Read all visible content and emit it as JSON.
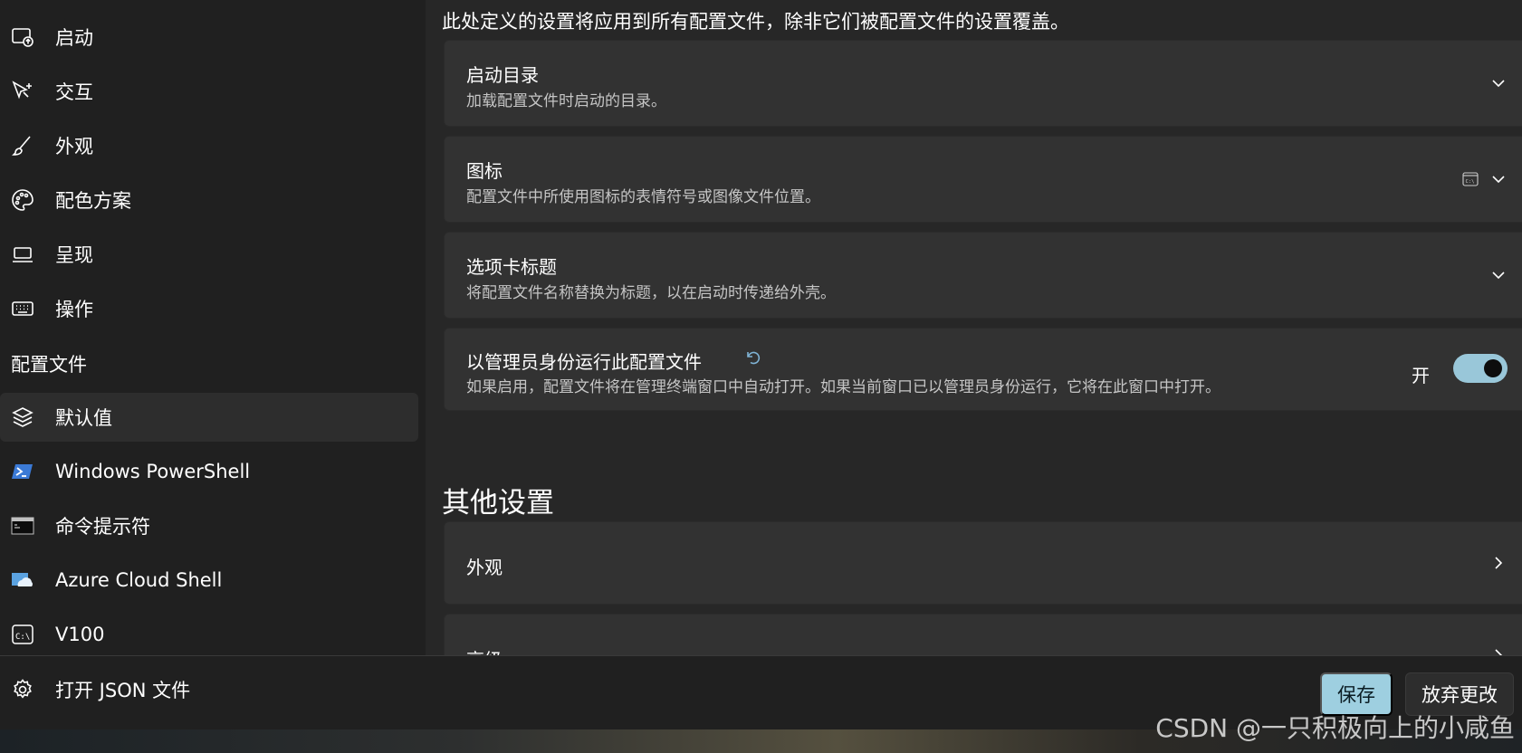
{
  "sidebar": {
    "items": [
      {
        "label": "启动",
        "icon": "startup-icon"
      },
      {
        "label": "交互",
        "icon": "interaction-icon"
      },
      {
        "label": "外观",
        "icon": "brush-icon"
      },
      {
        "label": "配色方案",
        "icon": "palette-icon"
      },
      {
        "label": "呈现",
        "icon": "laptop-icon"
      },
      {
        "label": "操作",
        "icon": "keyboard-icon"
      }
    ],
    "profiles_header": "配置文件",
    "profiles": [
      {
        "label": "默认值",
        "icon": "layers-icon",
        "selected": true
      },
      {
        "label": "Windows PowerShell",
        "icon": "powershell-icon"
      },
      {
        "label": "命令提示符",
        "icon": "cmd-icon"
      },
      {
        "label": "Azure Cloud Shell",
        "icon": "azure-icon"
      },
      {
        "label": "V100",
        "icon": "terminal-icon"
      }
    ],
    "open_json": {
      "label": "打开 JSON 文件",
      "icon": "gear-icon"
    }
  },
  "main": {
    "intro": "此处定义的设置将应用到所有配置文件，除非它们被配置文件的设置覆盖。",
    "cards": [
      {
        "title": "启动目录",
        "desc": "加载配置文件时启动的目录。"
      },
      {
        "title": "图标",
        "desc": "配置文件中所使用图标的表情符号或图像文件位置。"
      },
      {
        "title": "选项卡标题",
        "desc": "将配置文件名称替换为标题，以在启动时传递给外壳。"
      },
      {
        "title": "以管理员身份运行此配置文件",
        "desc": "如果启用，配置文件将在管理终端窗口中自动打开。如果当前窗口已以管理员身份运行，它将在此窗口中打开。",
        "toggle_label": "开",
        "toggle_on": true
      }
    ],
    "other_section_title": "其他设置",
    "other_cards": [
      {
        "title": "外观"
      },
      {
        "title": "高级"
      }
    ]
  },
  "footer": {
    "save_label": "保存",
    "discard_label": "放弃更改"
  },
  "watermark": "CSDN @一只积极向上的小咸鱼",
  "colors": {
    "accent": "#9ecfe0",
    "toggle_on": "#99c7d9",
    "card_bg": "#323232",
    "sidebar_bg": "#202020"
  }
}
